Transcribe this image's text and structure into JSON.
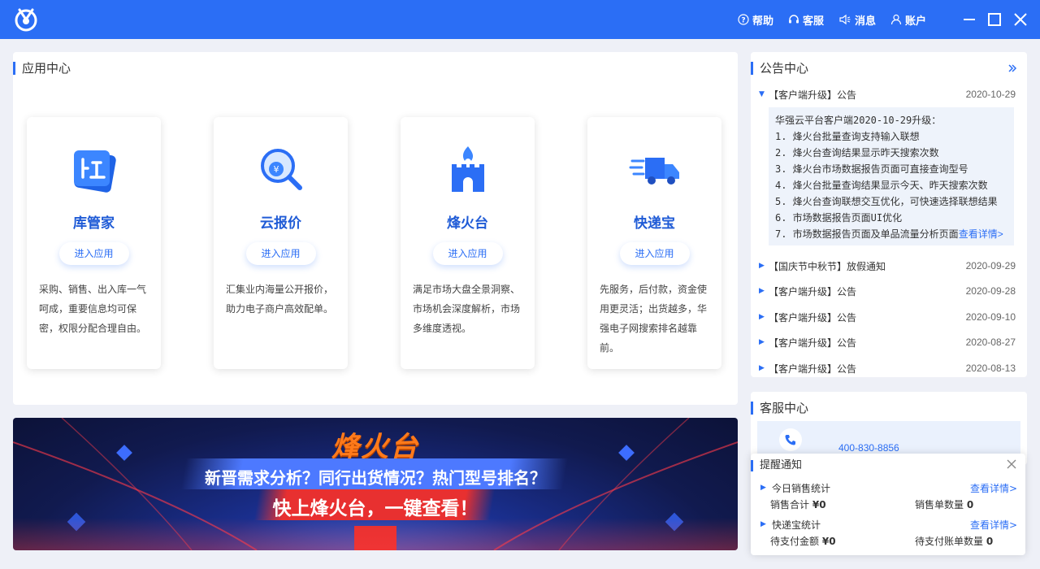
{
  "header": {
    "actions": [
      {
        "label": "帮助",
        "icon": "help-icon"
      },
      {
        "label": "客服",
        "icon": "headset-icon"
      },
      {
        "label": "消息",
        "icon": "speaker-icon"
      },
      {
        "label": "账户",
        "icon": "user-icon"
      }
    ]
  },
  "app_center": {
    "title": "应用中心",
    "apps": [
      {
        "name": "库管家",
        "enter_label": "进入应用",
        "description": "采购、销售、出入库一气呵成，重要信息均可保密，权限分配合理自由。",
        "icon": "warehouse-icon"
      },
      {
        "name": "云报价",
        "enter_label": "进入应用",
        "description": "汇集业内海量公开报价，助力电子商户高效配单。",
        "icon": "search-yen-icon"
      },
      {
        "name": "烽火台",
        "enter_label": "进入应用",
        "description": "满足市场大盘全景洞察、市场机会深度解析，市场多维度透视。",
        "icon": "beacon-tower-icon"
      },
      {
        "name": "快递宝",
        "enter_label": "进入应用",
        "description": "先服务，后付款，资金使用更灵活；出货越多，华强电子网搜索排名越靠前。",
        "icon": "delivery-truck-icon"
      }
    ]
  },
  "banner": {
    "title": "烽火台",
    "subtitle1": "新晋需求分析？同行出货情况？热门型号排名？",
    "subtitle2": "快上烽火台，一键查看！"
  },
  "notice_center": {
    "title": "公告中心",
    "expanded": {
      "title": "【客户端升级】公告",
      "date": "2020-10-29",
      "heading": "华强云平台客户端2020-10-29升级：",
      "items": [
        "1. 烽火台批量查询支持输入联想",
        "2. 烽火台查询结果显示昨天搜索次数",
        "3. 烽火台市场数据报告页面可直接查询型号",
        "4. 烽火台批量查询结果显示今天、昨天搜索次数",
        "5. 烽火台查询联想交互优化，可快速选择联想结果",
        "6. 市场数据报告页面UI优化",
        "7. 市场数据报告页面及单品流量分析页面"
      ],
      "more_label": "查看详情>"
    },
    "list": [
      {
        "title": "【国庆节中秋节】放假通知",
        "date": "2020-09-29"
      },
      {
        "title": "【客户端升级】公告",
        "date": "2020-09-28"
      },
      {
        "title": "【客户端升级】公告",
        "date": "2020-09-10"
      },
      {
        "title": "【客户端升级】公告",
        "date": "2020-08-27"
      },
      {
        "title": "【客户端升级】公告",
        "date": "2020-08-13"
      }
    ]
  },
  "service_center": {
    "title": "客服中心",
    "phone": "400-830-8856"
  },
  "reminder": {
    "title": "提醒通知",
    "sections": [
      {
        "label": "今日销售统计",
        "link": "查看详情>",
        "left_label": "销售合计",
        "left_value": "¥0",
        "right_label": "销售单数量",
        "right_value": "0"
      },
      {
        "label": "快递宝统计",
        "link": "查看详情>",
        "left_label": "待支付金额",
        "left_value": "¥0",
        "right_label": "待支付账单数量",
        "right_value": "0"
      }
    ]
  },
  "colors": {
    "primary": "#2b6ef5",
    "banner_orange": "#ff7a1a"
  }
}
